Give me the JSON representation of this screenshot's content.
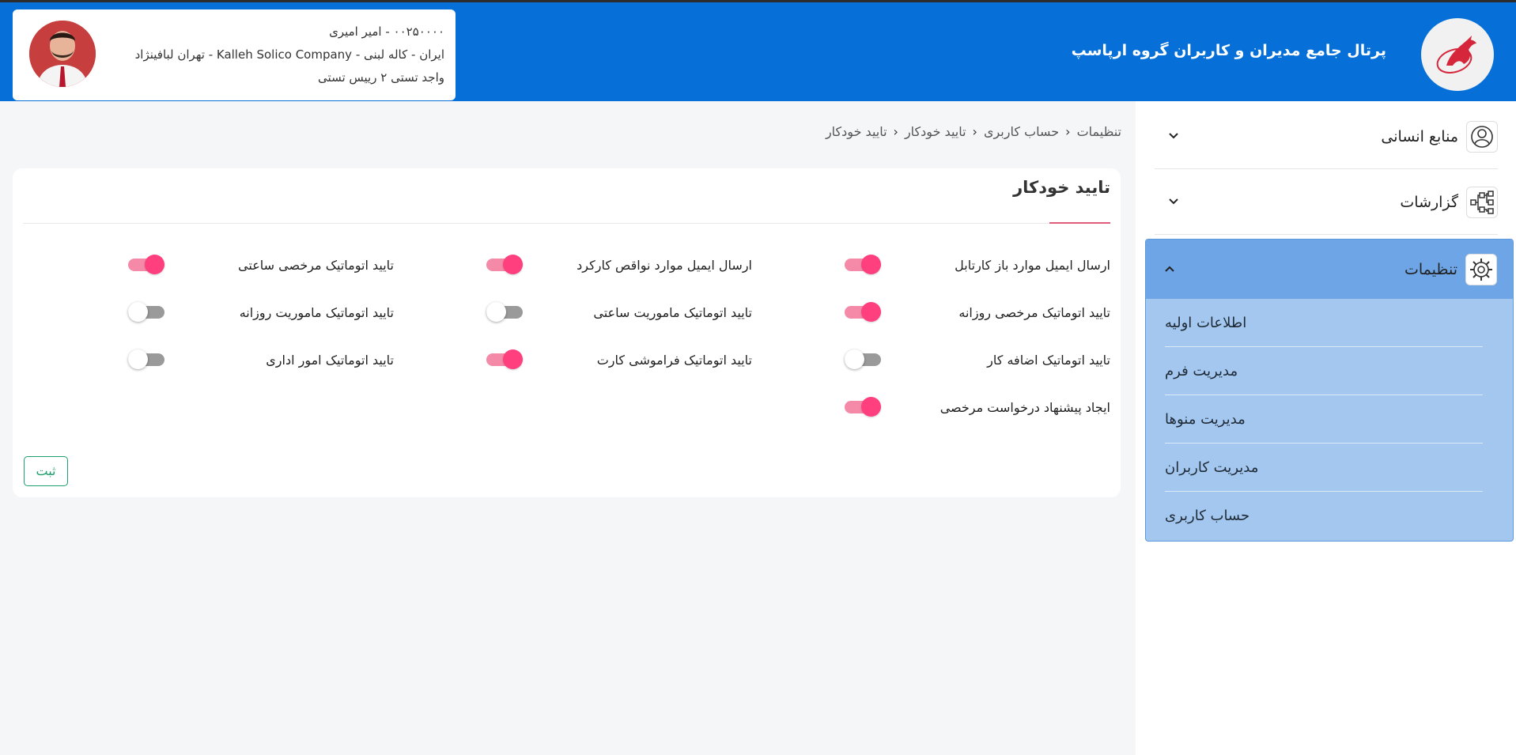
{
  "header": {
    "app_title": "پرتال جامع مدیران و کاربران گروه ارپاسپ",
    "user": {
      "line1": "۰۰۲۵۰۰۰۰ - امیر امیری",
      "line2": "ایران - کاله لبنی - Kalleh Solico Company - تهران لبافینژاد",
      "line3": "واجد تستی ۲ رییس تستی"
    }
  },
  "sidebar": {
    "items": [
      {
        "label": "منابع انسانی",
        "icon": "person-circle-icon",
        "expanded": false
      },
      {
        "label": "گزارشات",
        "icon": "hierarchy-icon",
        "expanded": false
      },
      {
        "label": "تنظیمات",
        "icon": "gear-icon",
        "expanded": true
      }
    ],
    "submenu": [
      "اطلاعات اولیه",
      "مدیریت فرم",
      "مدیریت منوها",
      "مدیریت کاربران",
      "حساب کاربری"
    ]
  },
  "breadcrumb": [
    "تنظیمات",
    "حساب کاربری",
    "تایید خودکار",
    "تایید خودکار"
  ],
  "panel": {
    "title": "تایید خودکار",
    "submit_label": "ثبت",
    "options": [
      {
        "label": "ارسال ایمیل موارد باز کارتابل",
        "on": true
      },
      {
        "label": "ارسال ایمیل موارد نواقص کارکرد",
        "on": true
      },
      {
        "label": "تایید اتوماتیک مرخصی ساعتی",
        "on": true
      },
      {
        "label": "تایید اتوماتیک مرخصی روزانه",
        "on": true
      },
      {
        "label": "تایید اتوماتیک ماموریت ساعتی",
        "on": false
      },
      {
        "label": "تایید اتوماتیک ماموریت روزانه",
        "on": false
      },
      {
        "label": "تایید اتوماتیک اضافه کار",
        "on": false
      },
      {
        "label": "تایید اتوماتیک فراموشی کارت",
        "on": true
      },
      {
        "label": "تایید اتوماتیک امور اداری",
        "on": false
      },
      {
        "label": "ایجاد پیشنهاد درخواست مرخصی",
        "on": true
      }
    ]
  },
  "colors": {
    "header_bg": "#0670d8",
    "toggle_on": "#ff3f7e",
    "toggle_off": "#9a9a9a",
    "submit_green": "#1e9e6a",
    "active_menu": "#a3c7ee"
  }
}
